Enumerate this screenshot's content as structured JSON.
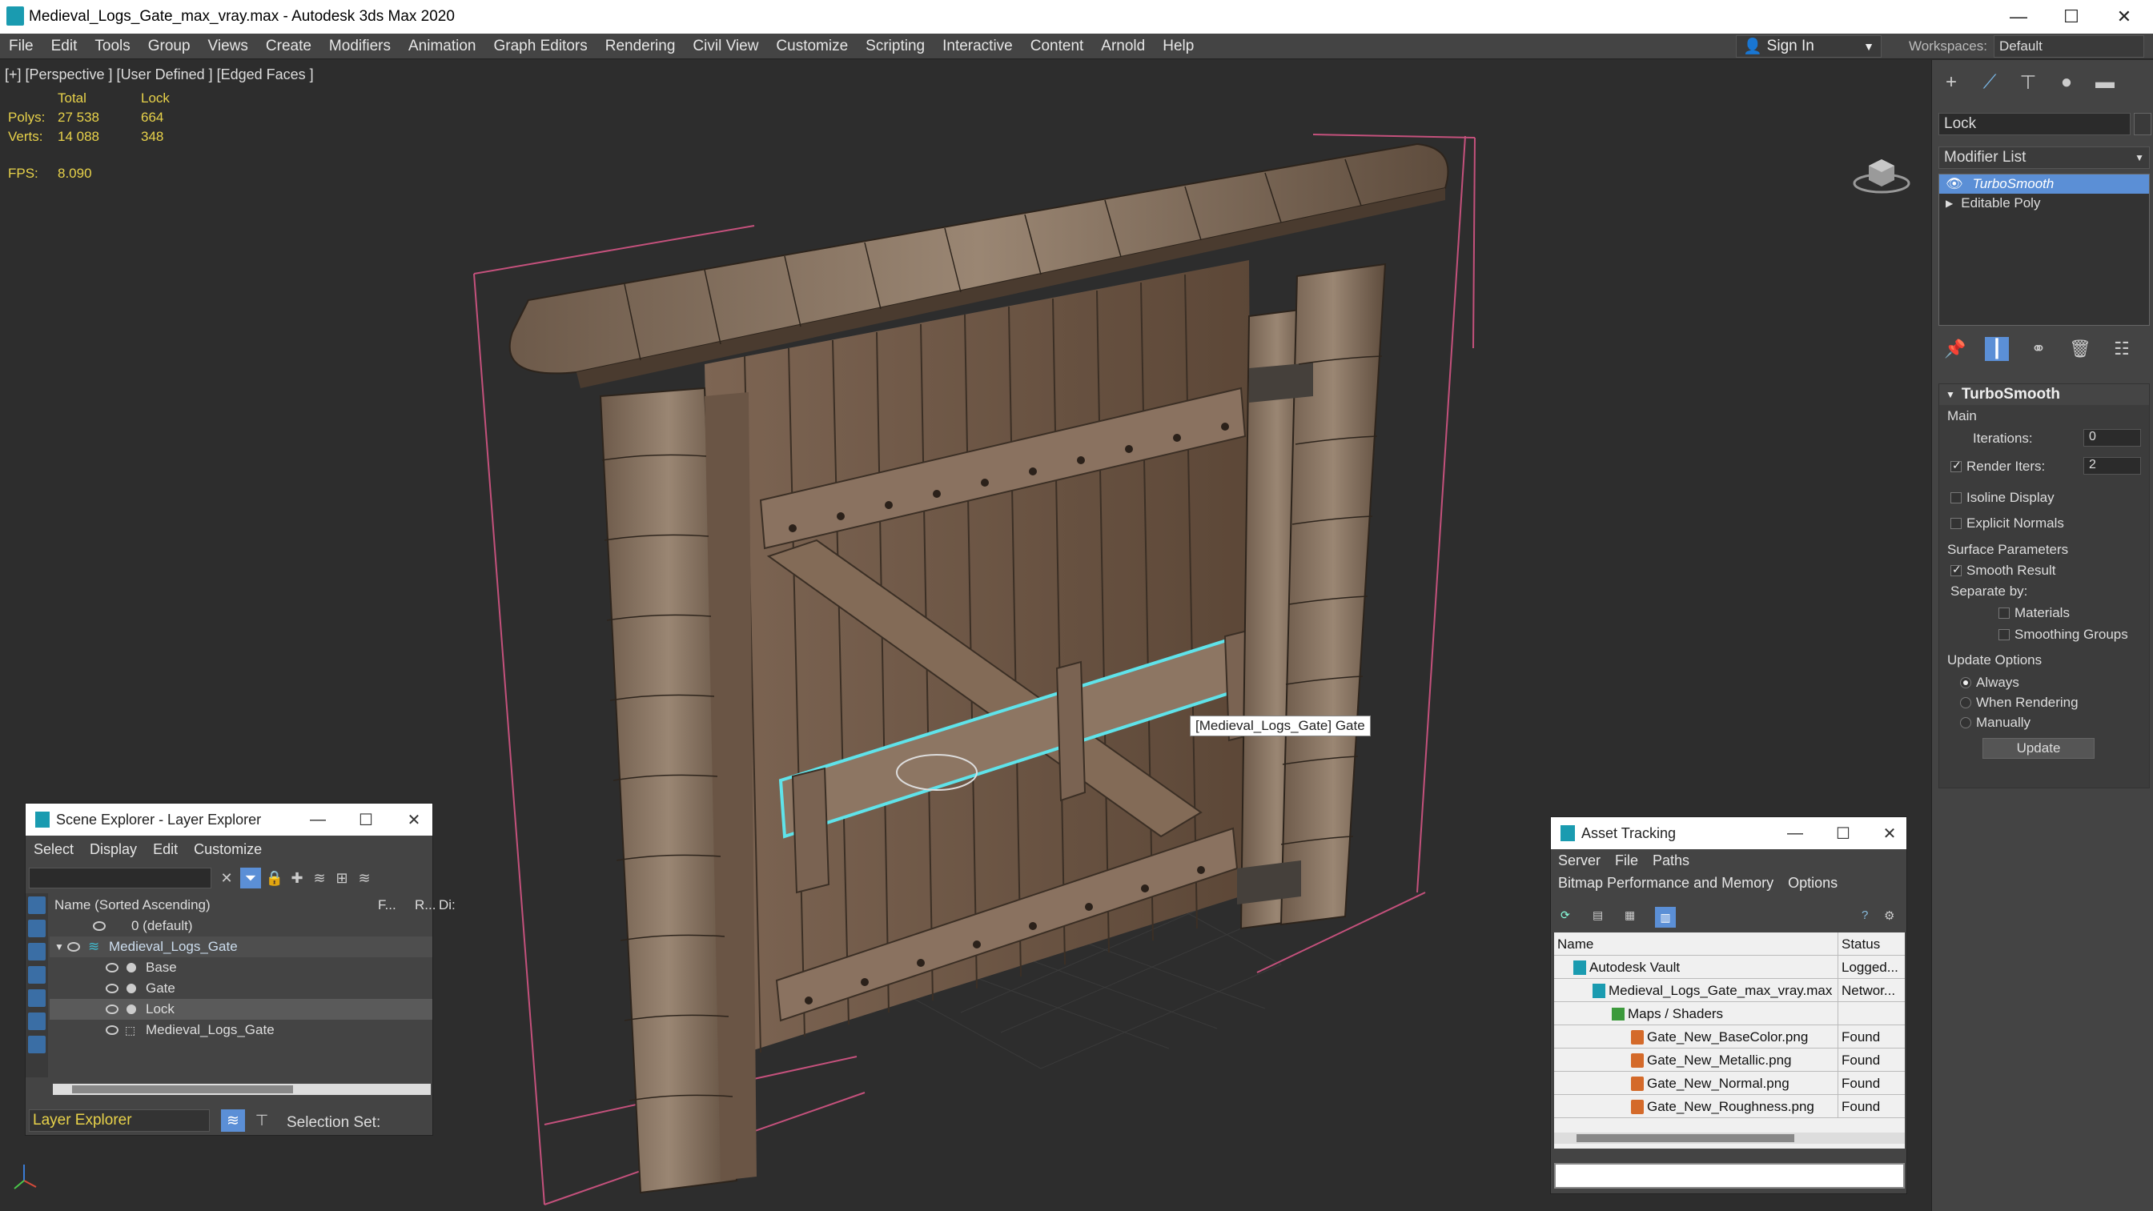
{
  "window": {
    "title": "Medieval_Logs_Gate_max_vray.max - Autodesk 3ds Max 2020",
    "minimize": "—",
    "maximize": "☐",
    "close": "✕"
  },
  "menu": [
    "File",
    "Edit",
    "Tools",
    "Group",
    "Views",
    "Create",
    "Modifiers",
    "Animation",
    "Graph Editors",
    "Rendering",
    "Civil View",
    "Customize",
    "Scripting",
    "Interactive",
    "Content",
    "Arnold",
    "Help"
  ],
  "signin": {
    "label": "Sign In"
  },
  "workspaces": {
    "label": "Workspaces:",
    "value": "Default"
  },
  "viewport": {
    "label": "[+] [Perspective ] [User Defined ] [Edged Faces ]",
    "stats": {
      "header_total": "Total",
      "header_lock": "Lock",
      "polys_label": "Polys:",
      "polys_total": "27 538",
      "polys_lock": "664",
      "verts_label": "Verts:",
      "verts_total": "14 088",
      "verts_lock": "348",
      "fps_label": "FPS:",
      "fps_value": "8.090"
    },
    "tooltip": "[Medieval_Logs_Gate] Gate"
  },
  "command_panel": {
    "object_name": "Lock",
    "modifier_list": "Modifier List",
    "stack": [
      "TurboSmooth",
      "Editable Poly"
    ],
    "turbosmooth": {
      "title": "TurboSmooth",
      "main": "Main",
      "iterations_label": "Iterations:",
      "iterations_value": "0",
      "render_iters_label": "Render Iters:",
      "render_iters_value": "2",
      "isoline": "Isoline Display",
      "explicit_normals": "Explicit Normals",
      "surface_params": "Surface Parameters",
      "smooth_result": "Smooth Result",
      "separate_by": "Separate by:",
      "materials": "Materials",
      "smoothing_groups": "Smoothing Groups",
      "update_options": "Update Options",
      "always": "Always",
      "when_rendering": "When Rendering",
      "manually": "Manually",
      "update_button": "Update"
    }
  },
  "scene_explorer": {
    "title": "Scene Explorer - Layer Explorer",
    "menu": [
      "Select",
      "Display",
      "Edit",
      "Customize"
    ],
    "columns": {
      "name": "Name (Sorted Ascending)",
      "f": "F...",
      "r": "R...",
      "d": "Di:"
    },
    "rows": [
      "0 (default)",
      "Medieval_Logs_Gate",
      "Base",
      "Gate",
      "Lock",
      "Medieval_Logs_Gate"
    ],
    "bottom_label": "Layer Explorer",
    "selection_set": "Selection Set:"
  },
  "asset_tracking": {
    "title": "Asset Tracking",
    "menu1": [
      "Server",
      "File",
      "Paths"
    ],
    "menu2": [
      "Bitmap Performance and Memory",
      "Options"
    ],
    "columns": {
      "name": "Name",
      "status": "Status"
    },
    "rows": [
      {
        "name": "Autodesk Vault",
        "status": "Logged..."
      },
      {
        "name": "Medieval_Logs_Gate_max_vray.max",
        "status": "Networ..."
      },
      {
        "name": "Maps / Shaders",
        "status": ""
      },
      {
        "name": "Gate_New_BaseColor.png",
        "status": "Found"
      },
      {
        "name": "Gate_New_Metallic.png",
        "status": "Found"
      },
      {
        "name": "Gate_New_Normal.png",
        "status": "Found"
      },
      {
        "name": "Gate_New_Roughness.png",
        "status": "Found"
      }
    ]
  }
}
